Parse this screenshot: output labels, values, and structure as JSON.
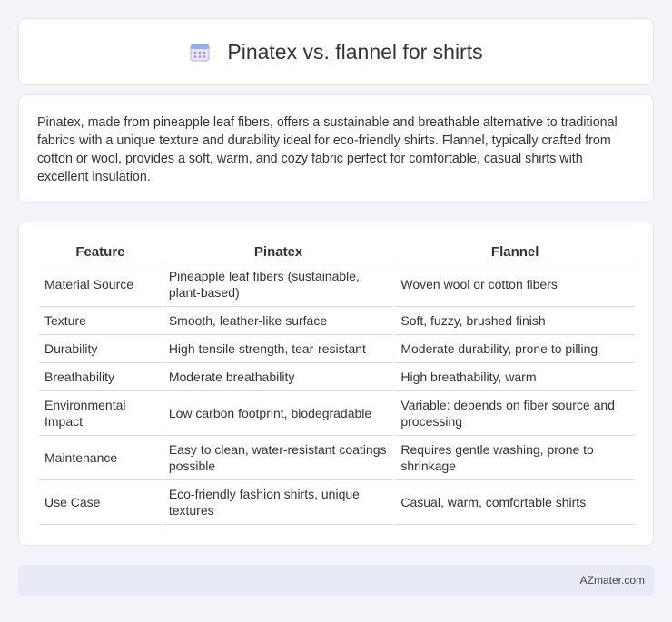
{
  "header": {
    "title": "Pinatex vs. flannel for shirts",
    "icon": "calendar-icon"
  },
  "intro": {
    "text": "Pinatex, made from pineapple leaf fibers, offers a sustainable and breathable alternative to traditional fabrics with a unique texture and durability ideal for eco-friendly shirts. Flannel, typically crafted from cotton or wool, provides a soft, warm, and cozy fabric perfect for comfortable, casual shirts with excellent insulation."
  },
  "table": {
    "headers": [
      "Feature",
      "Pinatex",
      "Flannel"
    ],
    "rows": [
      [
        "Material Source",
        "Pineapple leaf fibers (sustainable, plant-based)",
        "Woven wool or cotton fibers"
      ],
      [
        "Texture",
        "Smooth, leather-like surface",
        "Soft, fuzzy, brushed finish"
      ],
      [
        "Durability",
        "High tensile strength, tear-resistant",
        "Moderate durability, prone to pilling"
      ],
      [
        "Breathability",
        "Moderate breathability",
        "High breathability, warm"
      ],
      [
        "Environmental Impact",
        "Low carbon footprint, biodegradable",
        "Variable: depends on fiber source and processing"
      ],
      [
        "Maintenance",
        "Easy to clean, water-resistant coatings possible",
        "Requires gentle washing, prone to shrinkage"
      ],
      [
        "Use Case",
        "Eco-friendly fashion shirts, unique textures",
        "Casual, warm, comfortable shirts"
      ]
    ]
  },
  "footer": {
    "site": "AZmater.com"
  },
  "colors": {
    "background": "#f3f4f9",
    "card": "#ffffff",
    "footer": "#e8ebf5",
    "icon_accent": "#8a7fd6"
  }
}
